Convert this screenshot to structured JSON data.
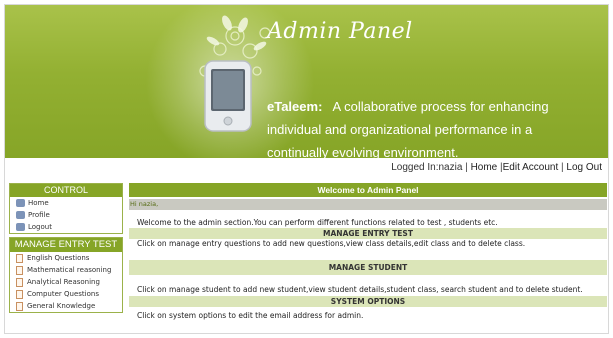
{
  "header": {
    "title": "Admin Panel",
    "brand": "eTaleem:",
    "tagline": "A collaborative process for enhancing individual and organizational performance in a continually evolving environment."
  },
  "toplinks": {
    "logged_in": "Logged In:nazia",
    "home": "Home",
    "edit_account": "Edit Account",
    "logout": "Log Out"
  },
  "sidebar": {
    "control_title": "CONTROL",
    "control_items": [
      "Home",
      "Profile",
      "Logout"
    ],
    "entry_title": "MANAGE ENTRY TEST",
    "entry_items": [
      "English Questions",
      "Mathematical reasoning",
      "Analytical Reasoning",
      "Computer Questions",
      "General Knowledge"
    ]
  },
  "main": {
    "heading": "Welcome to Admin Panel",
    "greeting": "Hi nazia,",
    "welcome_text": "Welcome to the admin section.You can perform different functions related to test , students etc.",
    "sections": [
      {
        "title": "MANAGE ENTRY TEST",
        "text": "Click on manage entry questions to add new questions,view class details,edit class and to delete class."
      },
      {
        "title": "MANAGE STUDENT",
        "text": "Click on manage student to add new student,view student details,student class, search student and to delete student."
      },
      {
        "title": "SYSTEM OPTIONS",
        "text": "Click on system options to edit the email address for admin."
      }
    ]
  },
  "colors": {
    "header_green": "#93b032",
    "bar_green": "#86a527",
    "section_bg": "#dbe5b8"
  }
}
